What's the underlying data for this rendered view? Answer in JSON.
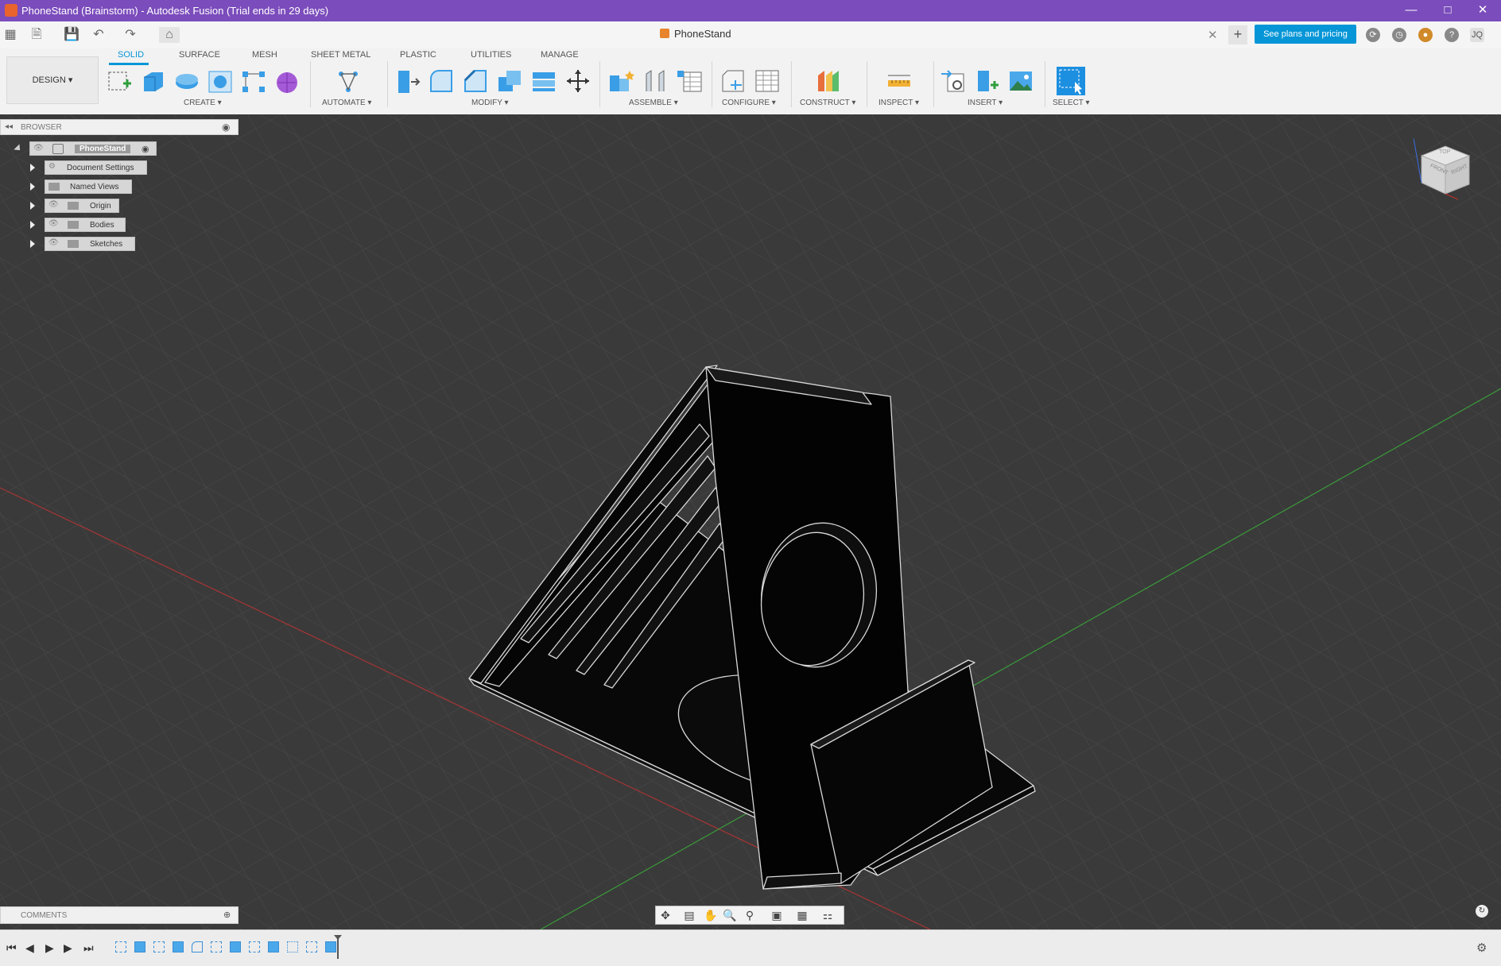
{
  "window": {
    "title": "PhoneStand (Brainstorm) - Autodesk Fusion (Trial ends in 29 days)",
    "controls": [
      "minimize-icon",
      "maximize-icon",
      "close-icon"
    ],
    "title_bar_color": "#7b4cbc"
  },
  "document": {
    "tab_label": "PhoneStand",
    "plans_button": "See plans and pricing",
    "user_initials": "JQ",
    "accent": "#0696d7"
  },
  "ribbon": {
    "workspace": "DESIGN",
    "tabs": [
      "SOLID",
      "SURFACE",
      "MESH",
      "SHEET METAL",
      "PLASTIC",
      "UTILITIES",
      "MANAGE"
    ],
    "active_tab": "SOLID",
    "groups": [
      "CREATE",
      "AUTOMATE",
      "MODIFY",
      "ASSEMBLE",
      "CONFIGURE",
      "CONSTRUCT",
      "INSPECT",
      "INSERT",
      "SELECT"
    ]
  },
  "browser": {
    "header": "BROWSER",
    "root": "PhoneStand",
    "items": [
      "Document Settings",
      "Named Views",
      "Origin",
      "Bodies",
      "Sketches"
    ]
  },
  "comments": {
    "label": "COMMENTS"
  },
  "viewcube": {
    "faces": [
      "FRONT",
      "RIGHT",
      "TOP"
    ]
  },
  "icons": {
    "ribbon_create": [
      "create-sketch-icon",
      "extrude-icon",
      "revolve-icon",
      "hole-icon",
      "pattern-icon",
      "form-icon"
    ],
    "ribbon_modify": [
      "press-pull-icon",
      "fillet-icon",
      "chamfer-icon",
      "combine-icon",
      "shell-icon",
      "move-icon"
    ],
    "nav": [
      "orbit-icon",
      "look-at-icon",
      "pan-icon",
      "zoom-icon",
      "fit-icon",
      "display-settings-icon",
      "grid-icon",
      "viewports-icon"
    ]
  }
}
